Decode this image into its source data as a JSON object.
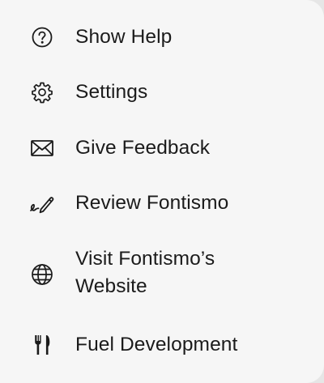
{
  "menu": {
    "items": [
      {
        "label": "Show Help",
        "icon": "question-circle-icon"
      },
      {
        "label": "Settings",
        "icon": "gear-icon"
      },
      {
        "label": "Give Feedback",
        "icon": "envelope-icon"
      },
      {
        "label": "Review Fontismo",
        "icon": "pencil-signature-icon"
      },
      {
        "label_lines": [
          "Visit Fontismo’s",
          "Website"
        ],
        "icon": "globe-icon"
      },
      {
        "label": "Fuel Development",
        "icon": "fork-knife-icon"
      }
    ]
  }
}
